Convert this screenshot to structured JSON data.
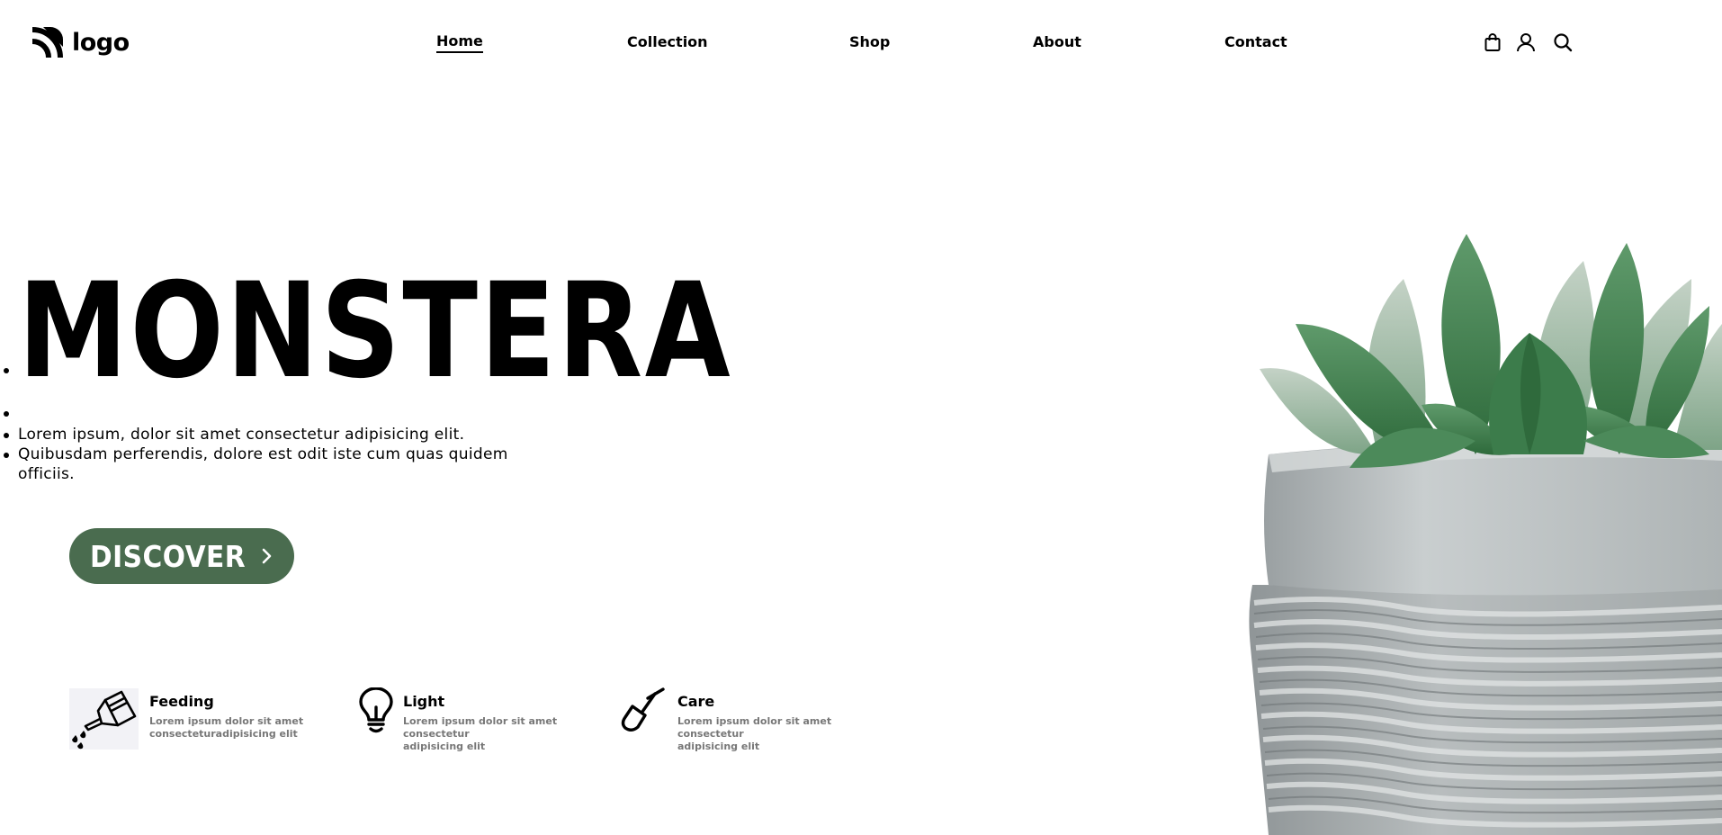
{
  "header": {
    "logo_text": "logo",
    "nav": [
      "Home",
      "Collection",
      "Shop",
      "About",
      "Contact"
    ],
    "active_nav": "Home",
    "icons": [
      "shopping-bag-icon",
      "user-icon",
      "search-icon"
    ]
  },
  "hero": {
    "title": "MONSTERA",
    "lines": [
      "Lorem ipsum, dolor sit amet consectetur adipisicing elit.",
      "Quibusdam perferendis, dolore est odit iste cum quas quidem",
      "officiis."
    ],
    "button_label": "DISCOVER",
    "button_icon": "chevron-right-icon"
  },
  "features": [
    {
      "title": "Feeding",
      "desc_lines": [
        "Lorem ipsum dolor sit amet",
        "consecteturadipisicing elit"
      ],
      "icon": "watering-can-icon"
    },
    {
      "title": "Light",
      "desc_lines": [
        "Lorem ipsum dolor sit amet consectetur",
        "adipisicing elit"
      ],
      "icon": "light-bulb-icon"
    },
    {
      "title": "Care",
      "desc_lines": [
        "Lorem ipsum dolor sit amet consectetur",
        "adipisicing elit"
      ],
      "icon": "shovel-icon"
    }
  ],
  "colors": {
    "accent": "#4a6c4f",
    "text": "#000000",
    "muted": "#777777",
    "background": "#ffffff"
  },
  "image": {
    "subject": "succulent-in-concrete-pot"
  }
}
